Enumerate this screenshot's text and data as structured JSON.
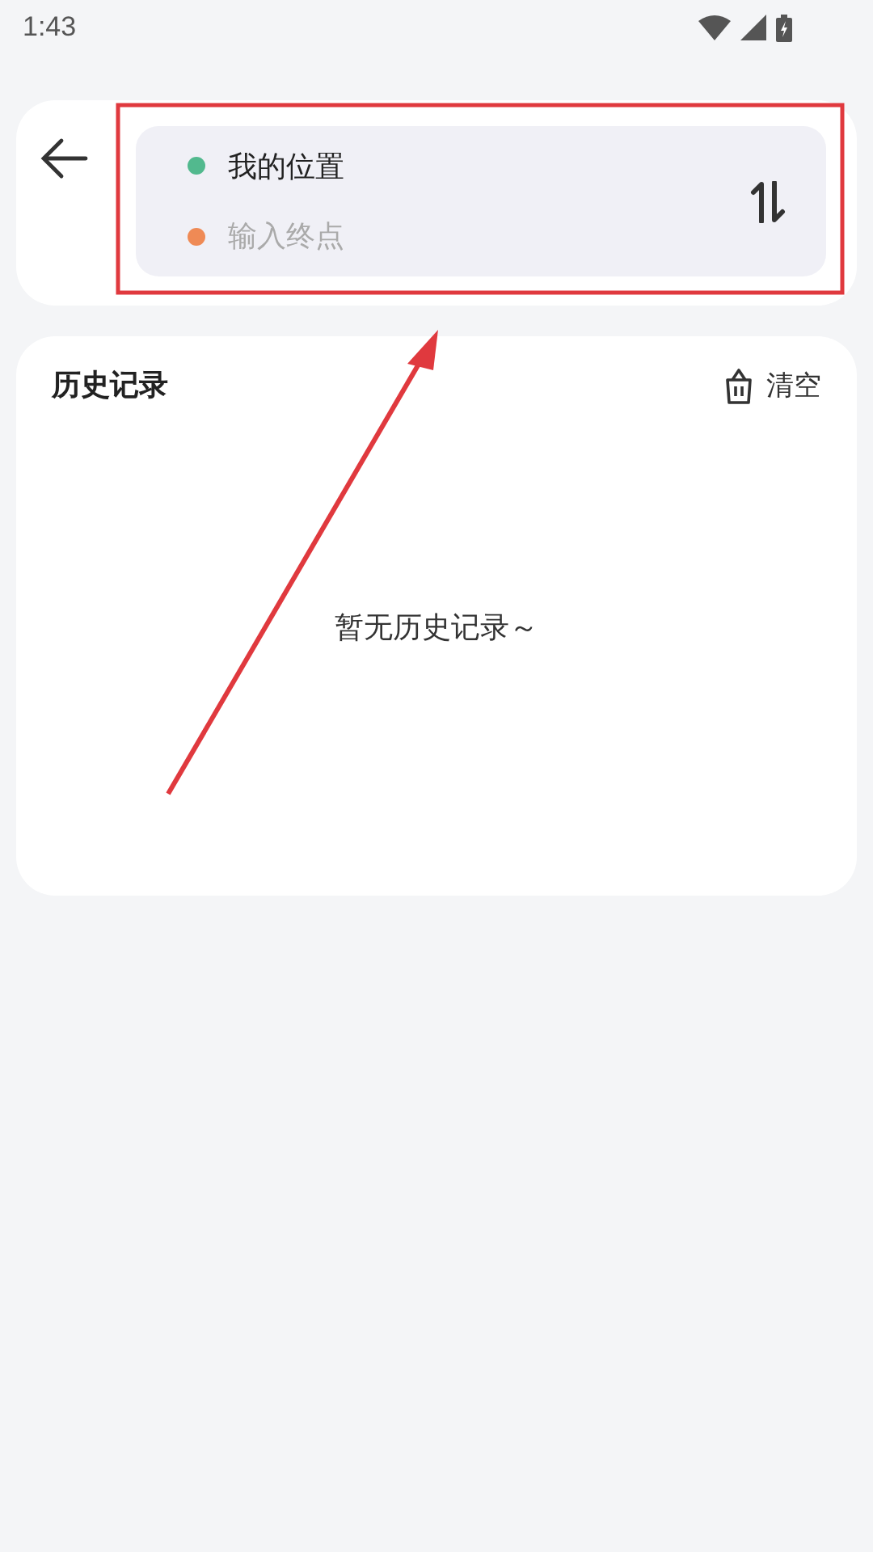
{
  "status_bar": {
    "time": "1:43"
  },
  "route": {
    "fields": [
      {
        "value": "我的位置",
        "color": "#52b98e"
      },
      {
        "placeholder": "输入终点",
        "color": "#ef8a55"
      }
    ]
  },
  "history": {
    "title": "历史记录",
    "clear_label": "清空",
    "empty_text": "暂无历史记录～"
  }
}
